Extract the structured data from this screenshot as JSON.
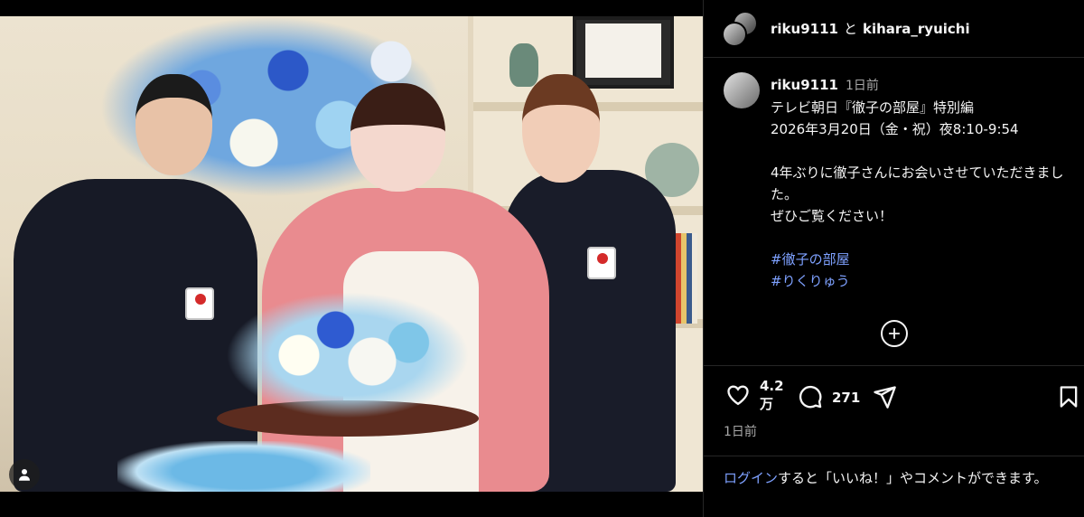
{
  "post": {
    "header": {
      "user1": "riku9111",
      "joiner": "と",
      "user2": "kihara_ryuichi"
    },
    "caption": {
      "username": "riku9111",
      "time": "1日前",
      "lines": [
        "テレビ朝日『徹子の部屋』特別編",
        "2026年3月20日（金・祝）夜8:10-9:54",
        "",
        "4年ぶりに徹子さんにお会いさせていただきました。",
        "ぜひご覧ください！",
        ""
      ],
      "hashtags": [
        "#徹子の部屋",
        "#りくりゅう"
      ]
    },
    "actions": {
      "like_count_line1": "4.2",
      "like_count_line2": "万",
      "comment_count": "271",
      "time_ago": "1日前"
    },
    "login": {
      "link": "ログイン",
      "rest": "すると「いいね！」やコメントができます。"
    }
  },
  "icons": {
    "like": "heart-icon",
    "comment": "comment-bubble-icon",
    "share": "paper-plane-icon",
    "save": "bookmark-icon",
    "more": "plus-circle-icon",
    "user": "person-icon"
  },
  "colors": {
    "background": "#000000",
    "link": "#7ea1ff",
    "muted": "#a8a8a8",
    "text": "#f5f5f5"
  }
}
